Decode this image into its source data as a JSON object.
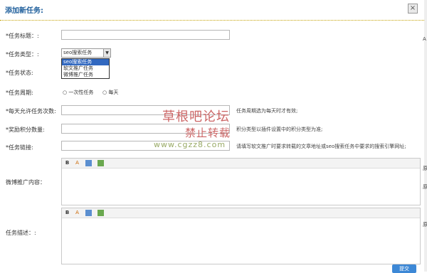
{
  "dialog": {
    "title": "添加新任务:",
    "close_symbol": "×",
    "submit_label": "提交"
  },
  "form": {
    "task_title_label": "*任务标题：:",
    "task_type_label": "*任务类型：:",
    "task_type_selected": "seo搜索任务",
    "task_type_options": [
      "seo搜索任务",
      "软文推广任务",
      "微博推广任务"
    ],
    "task_status_label": "*任务状态:",
    "task_cycle_label": "*任务周期:",
    "task_cycle_once": "一次性任务",
    "task_cycle_daily": "每天",
    "daily_limit_label": "*每天允许任务次数:",
    "daily_limit_hint": "任务周期选为每天时才有效;",
    "reward_label": "*奖励积分数量:",
    "reward_hint": "积分类型以插件设置中的积分类型为准;",
    "task_link_label": "*任务链接:",
    "task_link_hint": "请填写软文推广时要求转载的文章地址或seo搜索任务中要求的搜索引擎网址;",
    "weibo_content_label": "微博推广内容：",
    "task_desc_label": "任务描述：:",
    "editor_tools": [
      "B",
      "A",
      "img-icon",
      "link-icon"
    ]
  },
  "watermark": {
    "line1": "草根吧论坛",
    "line2": "禁止转载",
    "line3": "www.cgzz8.com"
  },
  "right_edge_text": [
    "A",
    "原",
    "原",
    "原"
  ]
}
